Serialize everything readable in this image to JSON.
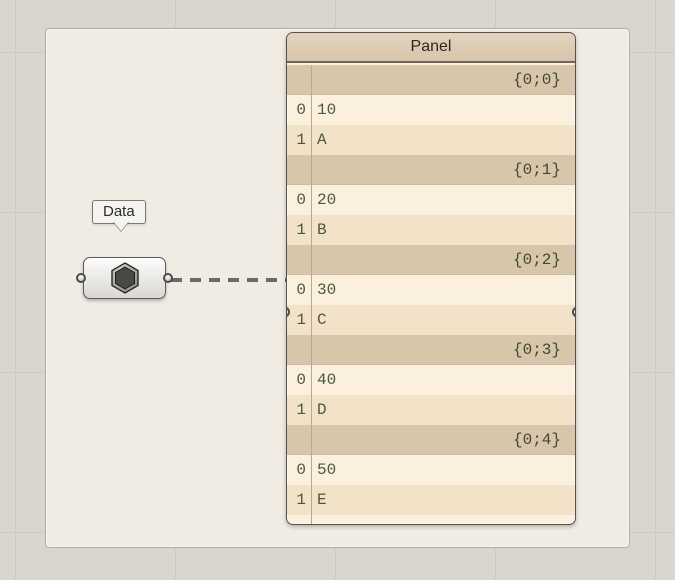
{
  "dataNode": {
    "label": "Data"
  },
  "panel": {
    "title": "Panel",
    "branches": [
      {
        "path": "{0;0}",
        "items": [
          {
            "index": "0",
            "value": "10"
          },
          {
            "index": "1",
            "value": "A"
          }
        ]
      },
      {
        "path": "{0;1}",
        "items": [
          {
            "index": "0",
            "value": "20"
          },
          {
            "index": "1",
            "value": "B"
          }
        ]
      },
      {
        "path": "{0;2}",
        "items": [
          {
            "index": "0",
            "value": "30"
          },
          {
            "index": "1",
            "value": "C"
          }
        ]
      },
      {
        "path": "{0;3}",
        "items": [
          {
            "index": "0",
            "value": "40"
          },
          {
            "index": "1",
            "value": "D"
          }
        ]
      },
      {
        "path": "{0;4}",
        "items": [
          {
            "index": "0",
            "value": "50"
          },
          {
            "index": "1",
            "value": "E"
          }
        ]
      }
    ]
  }
}
